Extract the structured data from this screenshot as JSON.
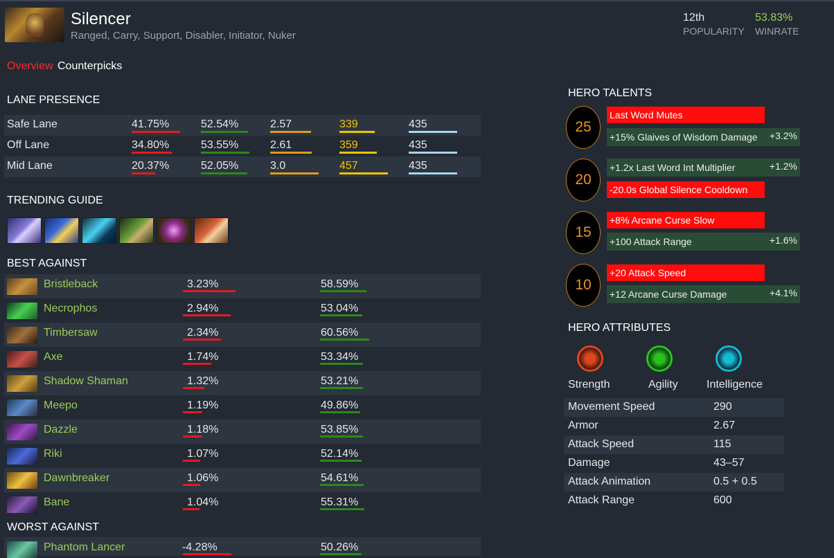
{
  "hero": {
    "name": "Silencer",
    "roles": "Ranged, Carry, Support, Disabler, Initiator, Nuker",
    "popularity_value": "12th",
    "popularity_label": "POPULARITY",
    "winrate_value": "53.83%",
    "winrate_label": "WINRATE"
  },
  "tabs": [
    {
      "label": "Overview",
      "active": true
    },
    {
      "label": "Counterpicks",
      "active": false
    }
  ],
  "lane_presence": {
    "title": "LANE PRESENCE",
    "rows": [
      {
        "lane": "Safe Lane",
        "presence": "41.75%",
        "winrate": "52.54%",
        "kda": "2.57",
        "gpm": "339",
        "xpm": "435"
      },
      {
        "lane": "Off Lane",
        "presence": "34.80%",
        "winrate": "53.55%",
        "kda": "2.61",
        "gpm": "359",
        "xpm": "435"
      },
      {
        "lane": "Mid Lane",
        "presence": "20.37%",
        "winrate": "52.05%",
        "kda": "3.0",
        "gpm": "457",
        "xpm": "435"
      }
    ]
  },
  "trending_guide": {
    "title": "TRENDING GUIDE",
    "items": [
      "item-1",
      "item-2",
      "item-3",
      "item-4",
      "item-5",
      "item-6"
    ]
  },
  "best_against": {
    "title": "BEST AGAINST",
    "rows": [
      {
        "name": "Bristleback",
        "advantage": "3.23%",
        "winrate": "58.59%"
      },
      {
        "name": "Necrophos",
        "advantage": "2.94%",
        "winrate": "53.04%"
      },
      {
        "name": "Timbersaw",
        "advantage": "2.34%",
        "winrate": "60.56%"
      },
      {
        "name": "Axe",
        "advantage": "1.74%",
        "winrate": "53.34%"
      },
      {
        "name": "Shadow Shaman",
        "advantage": "1.32%",
        "winrate": "53.21%"
      },
      {
        "name": "Meepo",
        "advantage": "1.19%",
        "winrate": "49.86%"
      },
      {
        "name": "Dazzle",
        "advantage": "1.18%",
        "winrate": "53.85%"
      },
      {
        "name": "Riki",
        "advantage": "1.07%",
        "winrate": "52.14%"
      },
      {
        "name": "Dawnbreaker",
        "advantage": "1.06%",
        "winrate": "54.61%"
      },
      {
        "name": "Bane",
        "advantage": "1.04%",
        "winrate": "55.31%"
      }
    ]
  },
  "worst_against": {
    "title": "WORST AGAINST",
    "rows": [
      {
        "name": "Phantom Lancer",
        "advantage": "-4.28%",
        "winrate": "50.26%"
      }
    ]
  },
  "talents": {
    "title": "HERO TALENTS",
    "tiers": [
      {
        "level": "25",
        "red": "Last Word Mutes",
        "green": "+15% Glaives of Wisdom Damage",
        "green_pct": "+3.2%"
      },
      {
        "level": "20",
        "green": "+1.2x Last Word Int Multiplier",
        "green_pct": "+1.2%",
        "red": "-20.0s Global Silence Cooldown"
      },
      {
        "level": "15",
        "red": "+8% Arcane Curse Slow",
        "green": "+100 Attack Range",
        "green_pct": "+1.6%"
      },
      {
        "level": "10",
        "red": "+20 Attack Speed",
        "green": "+12 Arcane Curse Damage",
        "green_pct": "+4.1%"
      }
    ]
  },
  "attributes": {
    "title": "HERO ATTRIBUTES",
    "primary": [
      {
        "label": "Strength",
        "color": "#e0451c",
        "icon": "strength-icon"
      },
      {
        "label": "Agility",
        "color": "#2ac31a",
        "icon": "agility-icon"
      },
      {
        "label": "Intelligence",
        "color": "#17b9d4",
        "icon": "intelligence-icon"
      }
    ],
    "stats": [
      {
        "key": "Movement Speed",
        "value": "290"
      },
      {
        "key": "Armor",
        "value": "2.67"
      },
      {
        "key": "Attack Speed",
        "value": "115"
      },
      {
        "key": "Damage",
        "value": "43–57"
      },
      {
        "key": "Attack Animation",
        "value": "0.5 + 0.5"
      },
      {
        "key": "Attack Range",
        "value": "600"
      }
    ]
  },
  "colors": {
    "accent_red": "#ff2a2a",
    "bar_red": "#e8191c",
    "bar_green": "#2a8a1a",
    "bar_orange": "#e29a1a",
    "bar_yellow": "#f2c500",
    "bar_lightblue": "#a8d6ee",
    "hero_link": "#9acd57",
    "gpm_text": "#f2c500"
  }
}
